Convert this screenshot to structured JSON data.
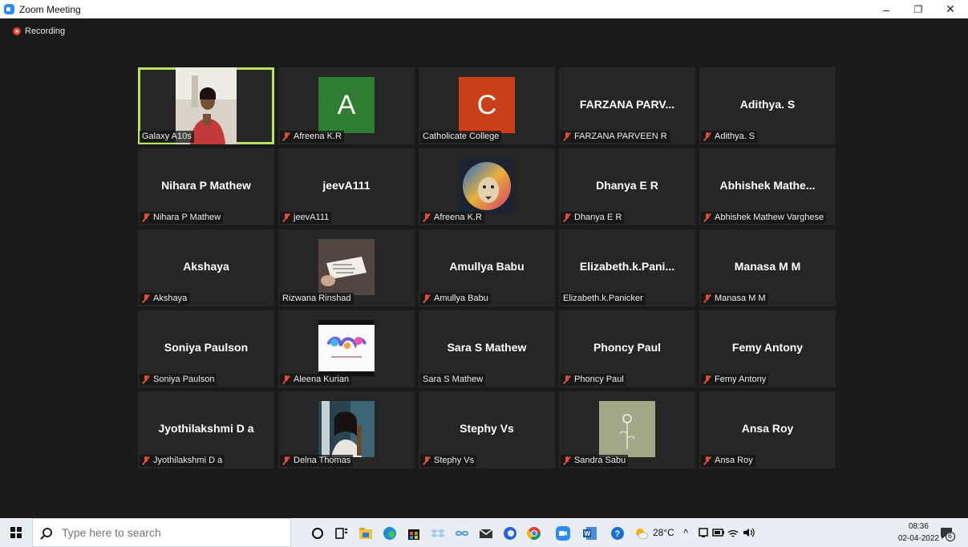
{
  "window": {
    "title": "Zoom Meeting",
    "minimize": "–",
    "restore": "❐",
    "close": "✕"
  },
  "recording": {
    "label": "Recording",
    "color": "#e0412e"
  },
  "tiles": [
    {
      "big": "",
      "label": "Galaxy A10s",
      "muted": false,
      "active": true,
      "kind": "video"
    },
    {
      "big": "",
      "label": "Afreena K.R",
      "muted": true,
      "kind": "letter",
      "letter": "A",
      "color": "#2e7d32"
    },
    {
      "big": "",
      "label": "Catholicate College",
      "muted": false,
      "kind": "letter",
      "letter": "C",
      "color": "#c9401b"
    },
    {
      "big": "FARZANA PARV...",
      "label": "FARZANA PARVEEN R",
      "muted": true
    },
    {
      "big": "Adithya. S",
      "label": "Adithya. S",
      "muted": true
    },
    {
      "big": "Nihara P Mathew",
      "label": "Nihara P Mathew",
      "muted": true
    },
    {
      "big": "jeevA111",
      "label": "jeevA111",
      "muted": true
    },
    {
      "big": "",
      "label": "Afreena K.R",
      "muted": true,
      "kind": "lion"
    },
    {
      "big": "Dhanya E R",
      "label": "Dhanya E R",
      "muted": true
    },
    {
      "big": "Abhishek  Mathe...",
      "label": "Abhishek Mathew Varghese",
      "muted": true
    },
    {
      "big": "Akshaya",
      "label": "Akshaya",
      "muted": true
    },
    {
      "big": "",
      "label": "Rizwana Rinshad",
      "muted": false,
      "kind": "paper"
    },
    {
      "big": "Amullya Babu",
      "label": "Amullya Babu",
      "muted": true
    },
    {
      "big": "Elizabeth.k.Pani...",
      "label": "Elizabeth.k.Panicker",
      "muted": false
    },
    {
      "big": "Manasa M M",
      "label": "Manasa M M",
      "muted": true
    },
    {
      "big": "Soniya Paulson",
      "label": "Soniya Paulson",
      "muted": true
    },
    {
      "big": "",
      "label": "Aleena Kurian",
      "muted": true,
      "kind": "art"
    },
    {
      "big": "Sara S Mathew",
      "label": "Sara S Mathew",
      "muted": false
    },
    {
      "big": "Phoncy Paul",
      "label": "Phoncy Paul",
      "muted": true
    },
    {
      "big": "Femy Antony",
      "label": "Femy Antony",
      "muted": true
    },
    {
      "big": "Jyothilakshmi D a",
      "label": "Jyothilakshmi D a",
      "muted": true
    },
    {
      "big": "",
      "label": "Delna Thomas",
      "muted": true,
      "kind": "girl"
    },
    {
      "big": "Stephy Vs",
      "label": "Stephy Vs",
      "muted": true
    },
    {
      "big": "",
      "label": "Sandra Sabu",
      "muted": true,
      "kind": "flower"
    },
    {
      "big": "Ansa Roy",
      "label": "Ansa Roy",
      "muted": true
    }
  ],
  "taskbar": {
    "search_placeholder": "Type here to search",
    "weather": "28°C",
    "time": "08:36",
    "date": "02-04-2022",
    "notifications": "6"
  }
}
